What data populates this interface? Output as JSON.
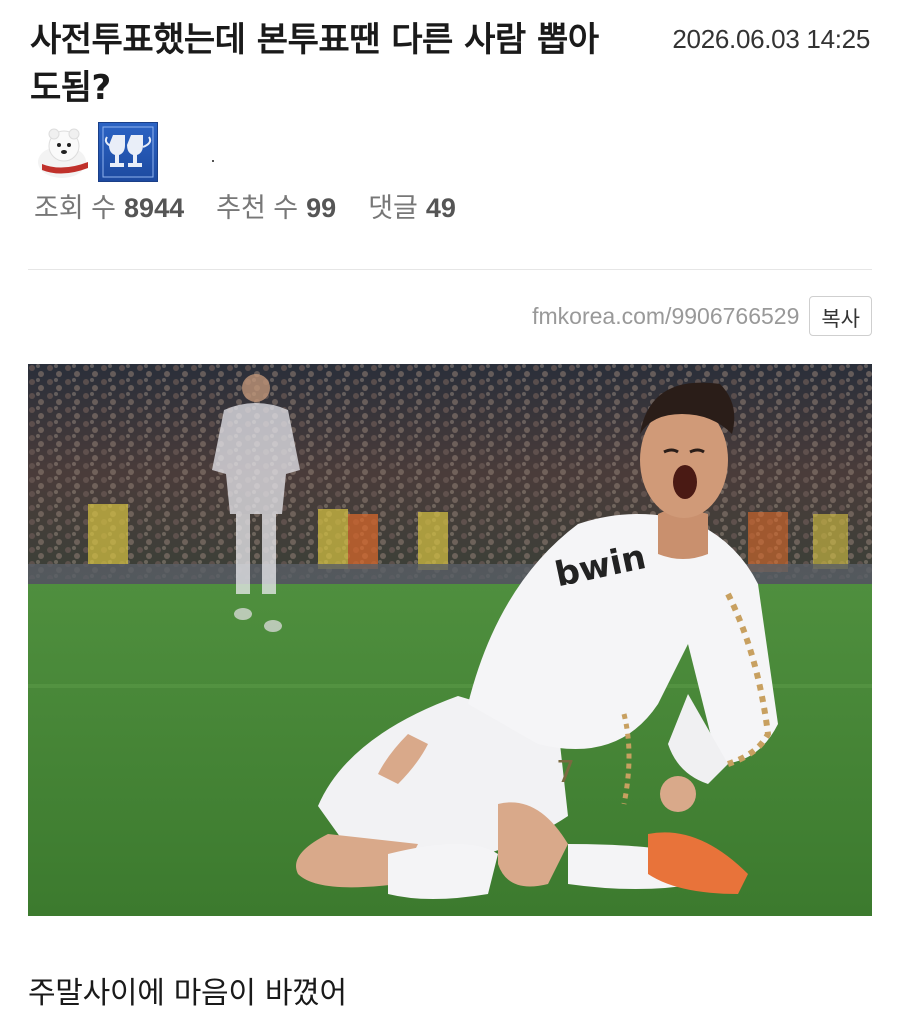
{
  "post": {
    "title": "사전투표했는데 본투표땐 다른 사람 뽑아도됨?",
    "datetime": "2026.06.03 14:25",
    "badges": [
      "bear-badge-icon",
      "trophy-badge-icon"
    ]
  },
  "stats": {
    "views_label": "조회 수",
    "views": "8944",
    "recommends_label": "추천 수",
    "recommends": "99",
    "comments_label": "댓글",
    "comments": "49"
  },
  "share": {
    "url": "fmkorea.com/9906766529",
    "copy_label": "복사"
  },
  "photo": {
    "jersey_text": "bwin",
    "number": "7"
  },
  "content": {
    "text": "주말사이에 마음이 바꼈어"
  }
}
